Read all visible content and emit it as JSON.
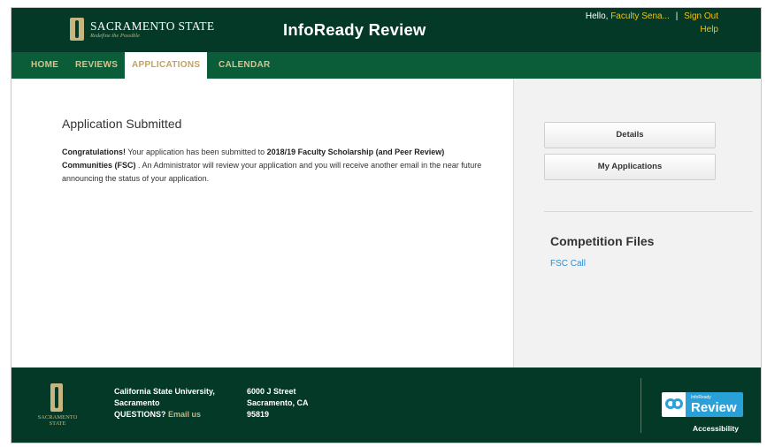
{
  "header": {
    "logo_name": "SACRAMENTO STATE",
    "logo_tagline": "Redefine the Possible",
    "app_title": "InfoReady Review",
    "greeting": "Hello, ",
    "user_name": "Faculty Sena...",
    "separator": "|",
    "sign_out": "Sign Out",
    "help": "Help"
  },
  "nav": {
    "items": [
      {
        "label": "HOME",
        "active": false
      },
      {
        "label": "REVIEWS",
        "active": false
      },
      {
        "label": "APPLICATIONS",
        "active": true
      },
      {
        "label": "CALENDAR",
        "active": false
      }
    ]
  },
  "main": {
    "title": "Application Submitted",
    "congrats": "Congratulations!",
    "text1": " Your application has been submitted to ",
    "competition": "2018/19 Faculty Scholarship (and Peer Review) Communities (FSC)",
    "text2": " . An Administrator will review your application and you will receive another email in the near future announcing the status of your application."
  },
  "sidebar": {
    "details_button": "Details",
    "my_applications_button": "My Applications",
    "files_title": "Competition Files",
    "files": [
      {
        "label": "FSC Call"
      }
    ]
  },
  "footer": {
    "logo_text": "SACRAMENTO STATE",
    "university_line1": "California State University,",
    "university_line2": "Sacramento",
    "questions_label": "QUESTIONS?",
    "email_link": "Email us",
    "address_line1": "6000 J Street",
    "address_line2": "Sacramento, CA",
    "address_line3": "95819",
    "badge_small": "InfoReady",
    "badge_big": "Review",
    "accessibility": "Accessibility"
  },
  "colors": {
    "brand_dark_green": "#043927",
    "nav_green": "#0b5d3a",
    "gold": "#c4b581",
    "link_blue": "#2b8fd6",
    "user_link_yellow": "#f0c419"
  }
}
